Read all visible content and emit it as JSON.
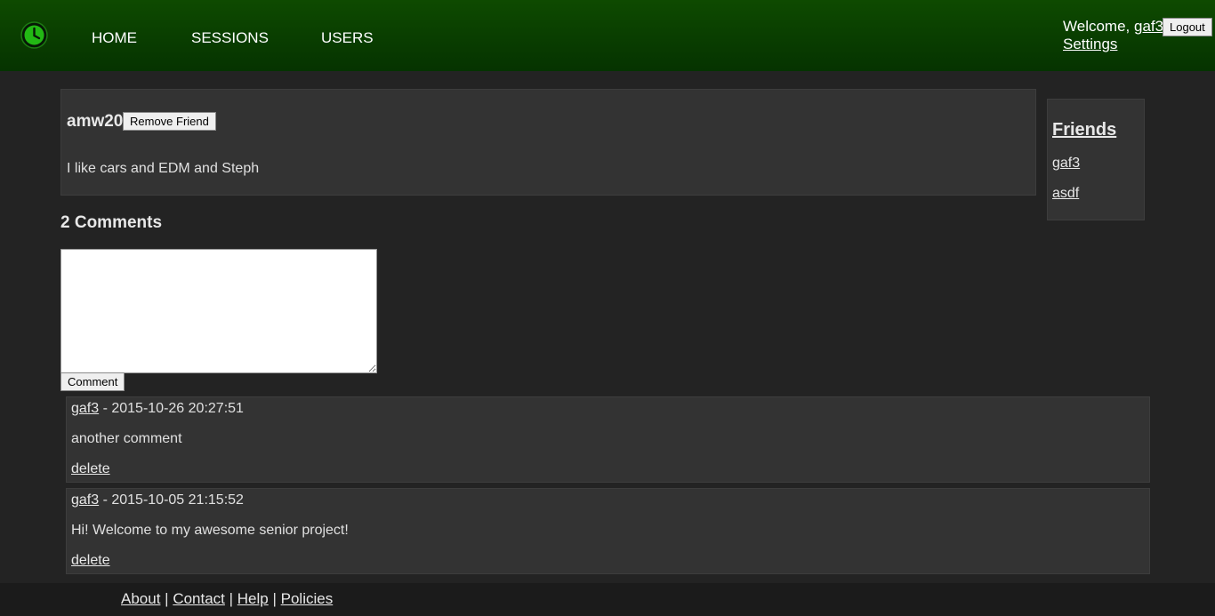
{
  "header": {
    "nav": [
      "HOME",
      "SESSIONS",
      "USERS"
    ],
    "welcome_prefix": "Welcome, ",
    "current_user": "gaf3",
    "logout_label": "Logout",
    "settings_label": "Settings"
  },
  "profile": {
    "username": "amw20",
    "remove_friend_label": "Remove Friend",
    "bio": "I like cars and EDM and Steph"
  },
  "friends": {
    "heading": "Friends",
    "items": [
      "gaf3",
      "asdf"
    ]
  },
  "comments": {
    "count_label": "2 Comments",
    "input_placeholder": "",
    "submit_label": "Comment",
    "items": [
      {
        "author": "gaf3",
        "meta": " - 2015-10-26 20:27:51",
        "body": "another comment",
        "delete_label": "delete"
      },
      {
        "author": "gaf3",
        "meta": " - 2015-10-05 21:15:52",
        "body": "Hi! Welcome to my awesome senior project!",
        "delete_label": "delete"
      }
    ]
  },
  "footer": {
    "links": [
      "About",
      "Contact",
      "Help",
      "Policies"
    ],
    "separator": " | "
  },
  "colors": {
    "header_top": "#0e4a00",
    "header_bottom": "#053300",
    "background": "#232323",
    "panel": "#333333",
    "logo_accent": "#22b814"
  }
}
